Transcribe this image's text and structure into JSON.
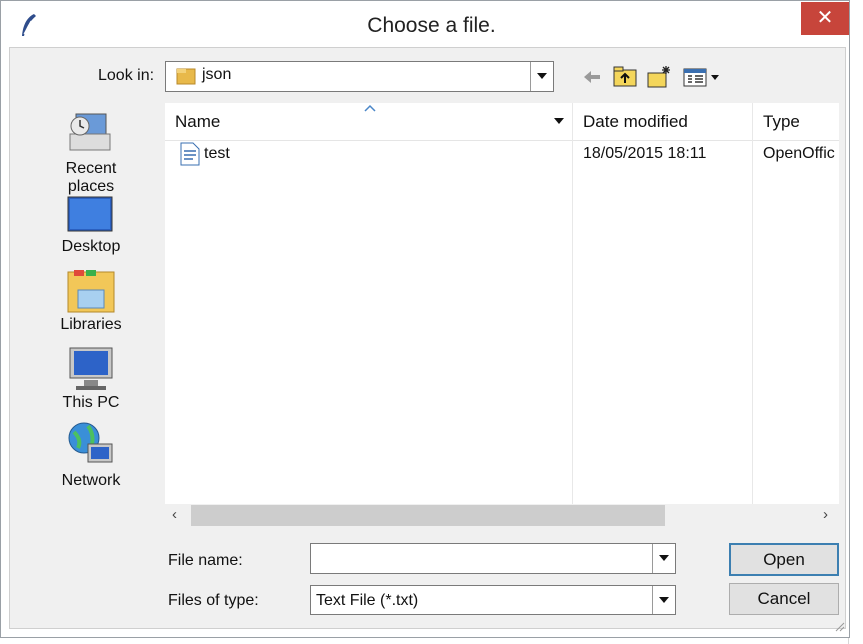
{
  "window": {
    "title": "Choose a file.",
    "close_glyph": "✕"
  },
  "lookin": {
    "label": "Look in:",
    "value": "json"
  },
  "toolbar": {
    "icons": [
      "back-arrow-icon",
      "up-folder-icon",
      "new-folder-icon",
      "view-menu-icon"
    ]
  },
  "places": [
    {
      "label": "Recent places",
      "icon": "recent-places-icon"
    },
    {
      "label": "Desktop",
      "icon": "desktop-icon"
    },
    {
      "label": "Libraries",
      "icon": "libraries-icon"
    },
    {
      "label": "This PC",
      "icon": "this-pc-icon"
    },
    {
      "label": "Network",
      "icon": "network-icon"
    }
  ],
  "list": {
    "columns": [
      "Name",
      "Date modified",
      "Type"
    ],
    "rows": [
      {
        "name": "test",
        "date": "18/05/2015 18:11",
        "type": "OpenOffic"
      }
    ]
  },
  "scroll": {
    "left": "‹",
    "right": "›"
  },
  "filename": {
    "label": "File name:",
    "value": ""
  },
  "filetype": {
    "label": "Files of type:",
    "value": "Text File (*.txt)"
  },
  "buttons": {
    "open": "Open",
    "cancel": "Cancel"
  },
  "colors": {
    "close": "#c7453b",
    "accent": "#3c7fb1"
  }
}
